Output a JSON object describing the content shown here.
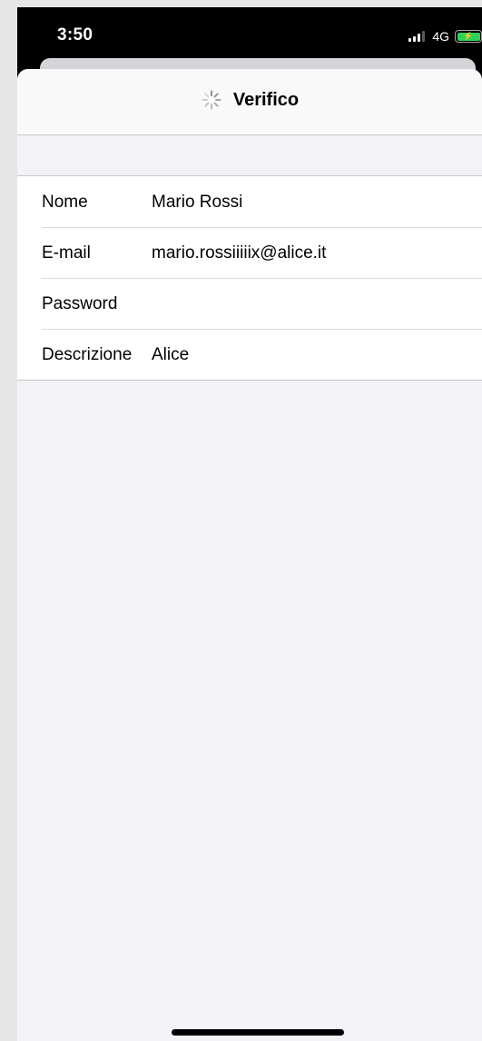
{
  "status_bar": {
    "time": "3:50",
    "network": "4G",
    "icons": [
      "signal-icon",
      "battery-charging-icon"
    ],
    "battery_color": "#30d158"
  },
  "nav": {
    "title": "Verifico",
    "icon": "spinner-icon"
  },
  "form": {
    "rows": [
      {
        "label": "Nome",
        "value": "Mario Rossi"
      },
      {
        "label": "E-mail",
        "value": "mario.rossiiiiix@alice.it"
      },
      {
        "label": "Password",
        "value": ""
      },
      {
        "label": "Descrizione",
        "value": "Alice"
      }
    ]
  },
  "colors": {
    "background": "#f2f2f7",
    "nav_background": "#f9f9f9",
    "separator": "#c8c7cc"
  }
}
